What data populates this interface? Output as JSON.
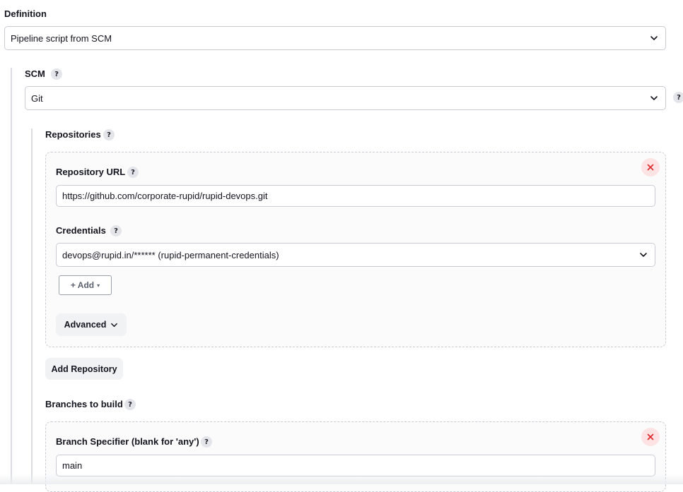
{
  "definition": {
    "label": "Definition",
    "selected": "Pipeline script from SCM"
  },
  "scm": {
    "label": "SCM",
    "help": "?",
    "selected": "Git",
    "outer_help": "?"
  },
  "repositories": {
    "label": "Repositories",
    "help": "?",
    "repo": {
      "close": "×",
      "url_label": "Repository URL",
      "url_help": "?",
      "url_value": "https://github.com/corporate-rupid/rupid-devops.git",
      "credentials_label": "Credentials",
      "credentials_help": "?",
      "credentials_selected": "devops@rupid.in/****** (rupid-permanent-credentials)",
      "add_label": "+ Add",
      "add_caret": "▾",
      "advanced_label": "Advanced"
    },
    "add_repository_label": "Add Repository"
  },
  "branches": {
    "label": "Branches to build",
    "help": "?",
    "branch": {
      "close": "×",
      "specifier_label": "Branch Specifier (blank for 'any')",
      "specifier_help": "?",
      "specifier_value": "main"
    }
  },
  "colors": {
    "close_bg": "#fde3e3",
    "close_x": "#e0262a",
    "help_bg": "#e4e5ea",
    "border": "#cbccd3"
  }
}
